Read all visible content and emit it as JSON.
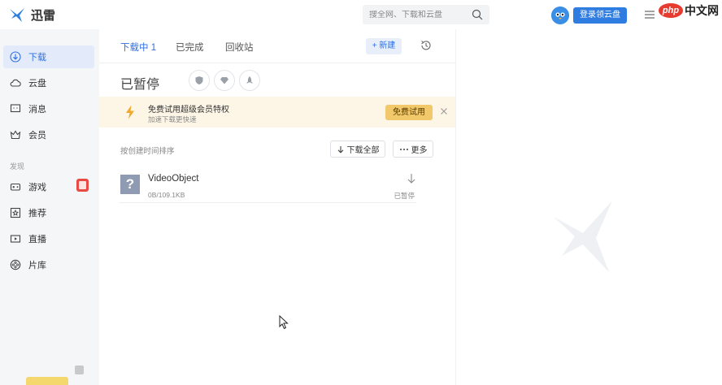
{
  "app": {
    "name": "迅雷"
  },
  "search": {
    "placeholder": "搜全网、下载和云盘"
  },
  "header": {
    "login_label": "登录领云盘"
  },
  "watermark_badge": {
    "php": "php",
    "cn": "中文网"
  },
  "sidebar": {
    "items": [
      {
        "label": "下载",
        "icon": "download-icon"
      },
      {
        "label": "云盘",
        "icon": "cloud-icon"
      },
      {
        "label": "消息",
        "icon": "message-icon"
      },
      {
        "label": "会员",
        "icon": "vip-icon"
      }
    ],
    "section_label": "发现",
    "discover": [
      {
        "label": "游戏",
        "icon": "gamepad-icon"
      },
      {
        "label": "推荐",
        "icon": "recommend-icon"
      },
      {
        "label": "直播",
        "icon": "live-icon"
      },
      {
        "label": "片库",
        "icon": "film-icon"
      }
    ]
  },
  "tabs": [
    {
      "label": "下载中 1"
    },
    {
      "label": "已完成"
    },
    {
      "label": "回收站"
    }
  ],
  "toolbar": {
    "new_label": "+ 新建"
  },
  "status": {
    "title": "已暂停"
  },
  "banner": {
    "title": "免费试用超级会员特权",
    "subtitle": "加速下载更快速",
    "trial_label": "免费试用"
  },
  "list": {
    "sort_label": "按创建时间排序",
    "download_all_label": "下载全部",
    "more_label": "更多"
  },
  "tasks": [
    {
      "name": "VideoObject",
      "size": "0B/109.1KB",
      "state": "已暂停"
    }
  ],
  "colors": {
    "accent": "#2f6fe0",
    "banner_bg": "#fdf5e6",
    "trial_button": "#f1c86a"
  }
}
